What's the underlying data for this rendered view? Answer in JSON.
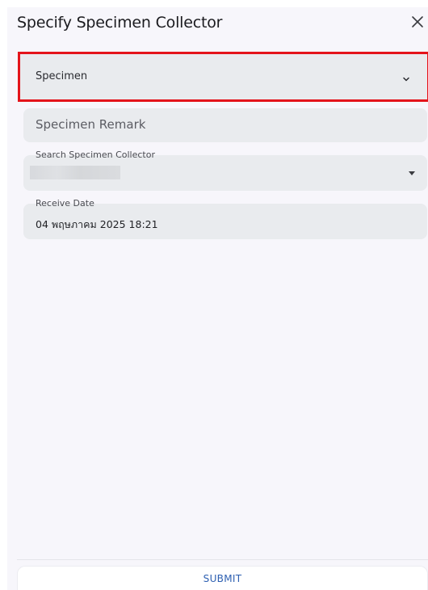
{
  "dialog": {
    "title": "Specify Specimen Collector",
    "close_icon": "close-icon"
  },
  "specimen_select": {
    "value": "Specimen",
    "icon": "chevron-down-icon",
    "highlight_color": "#e4141b"
  },
  "specimen_remark": {
    "placeholder": "Specimen Remark"
  },
  "specimen_collector": {
    "label": "Search Specimen Collector",
    "icon": "caret-down-icon"
  },
  "receive_date": {
    "label": "Receive Date",
    "value": "04 พฤษภาคม 2025 18:21"
  },
  "footer": {
    "submit_label": "SUBMIT"
  },
  "colors": {
    "field_bg": "#e9ebee",
    "panel_bg": "#f7f6fb",
    "accent": "#2d5fb1"
  }
}
